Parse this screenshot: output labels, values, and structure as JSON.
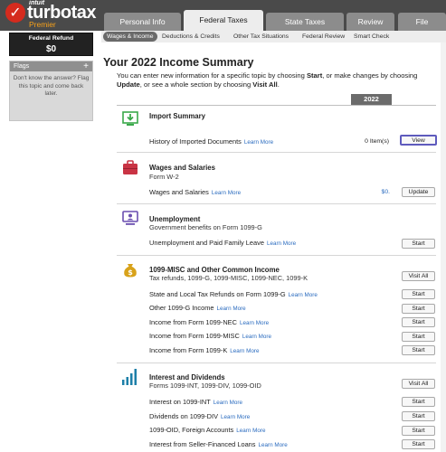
{
  "brand": {
    "intuit": "intuit",
    "name": "turbotax",
    "edition": "Premier"
  },
  "tabs": [
    {
      "label": "Personal Info",
      "active": false
    },
    {
      "label": "Federal Taxes",
      "active": true
    },
    {
      "label": "State Taxes",
      "active": false
    },
    {
      "label": "Review",
      "active": false
    },
    {
      "label": "File",
      "active": false
    }
  ],
  "subtabs": [
    "Wages & Income",
    "Deductions & Credits",
    "Other Tax Situations",
    "Federal Review",
    "Smart Check"
  ],
  "sidebar": {
    "refund_label": "Federal Refund",
    "refund_value": "$0",
    "flags_title": "Flags",
    "flags_plus": "+",
    "flags_text": "Don't know the answer? Flag this topic and come back later."
  },
  "main": {
    "title": "Your 2022 Income Summary",
    "intro": {
      "p1": "You can enter new information for a specific topic by choosing ",
      "b1": "Start",
      "p2": ", or make changes by choosing ",
      "b2": "Update",
      "p3": ", or see a whole section by choosing ",
      "b3": "Visit All",
      "p4": "."
    },
    "year": "2022",
    "learn_more": "Learn More",
    "sections": {
      "import": {
        "title": "Import Summary",
        "row": "History of Imported Documents",
        "count": "0 Item(s)",
        "button": "View"
      },
      "wages": {
        "title": "Wages and Salaries",
        "subtitle": "Form W-2",
        "row": "Wages and Salaries",
        "amount": "$0.",
        "button": "Update"
      },
      "unemployment": {
        "title": "Unemployment",
        "subtitle": "Government benefits on Form 1099-G",
        "row": "Unemployment and Paid Family Leave",
        "button": "Start"
      },
      "misc": {
        "title": "1099-MISC and Other Common Income",
        "subtitle": "Tax refunds, 1099-G, 1099-MISC, 1099-NEC, 1099-K",
        "visit": "Visit All",
        "rows": [
          {
            "label": "State and Local Tax Refunds on Form 1099-G",
            "button": "Start"
          },
          {
            "label": "Other 1099-G Income",
            "button": "Start"
          },
          {
            "label": "Income from Form 1099-NEC",
            "button": "Start"
          },
          {
            "label": "Income from Form 1099-MISC",
            "button": "Start"
          },
          {
            "label": "Income from Form 1099-K",
            "button": "Start"
          }
        ]
      },
      "interest": {
        "title": "Interest and Dividends",
        "subtitle": "Forms 1099-INT, 1099-DIV, 1099-OID",
        "visit": "Visit All",
        "rows": [
          {
            "label": "Interest on 1099-INT",
            "button": "Start"
          },
          {
            "label": "Dividends on 1099-DIV",
            "button": "Start"
          },
          {
            "label": "1099-OID, Foreign Accounts",
            "button": "Start"
          },
          {
            "label": "Interest from Seller-Financed Loans",
            "button": "Start"
          }
        ]
      }
    }
  },
  "colors": {
    "header": "#4a4a4a",
    "accent_red": "#d52b1e",
    "premier_orange": "#f7a11a",
    "link": "#2a6bbf",
    "icon_green": "#3aa84a",
    "icon_red": "#c93444",
    "icon_purple": "#6a4fb0",
    "icon_gold": "#d8a21a",
    "icon_teal": "#1d7fa8"
  },
  "icons": [
    "download-tray-icon",
    "briefcase-icon",
    "monitor-person-icon",
    "money-bag-icon",
    "bar-chart-icon",
    "checkmark-logo-icon"
  ]
}
